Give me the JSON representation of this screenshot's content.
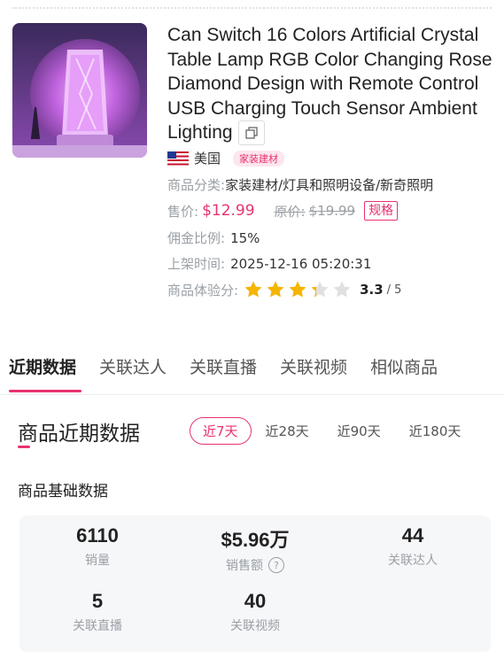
{
  "product": {
    "title": "Can Switch 16 Colors Artificial Crystal Table Lamp RGB Color Changing Rose Diamond Design with Remote Control USB Charging Touch Sensor Ambient Lighting",
    "country": "美国",
    "category_tag": "家装建材",
    "category_label": "商品分类:",
    "category_value": "家装建材/灯具和照明设备/新奇照明",
    "price_label": "售价:",
    "price": "$12.99",
    "original_price_label": "原价:",
    "original_price": "$19.99",
    "spec_button": "规格",
    "commission_label": "佣金比例:",
    "commission": "15%",
    "listed_label": "上架时间:",
    "listed_time": "2025-12-16 05:20:31",
    "rating_label": "商品体验分:",
    "rating": 3.3,
    "rating_text": "3.3",
    "rating_max": "/ 5"
  },
  "tabs": [
    "近期数据",
    "关联达人",
    "关联直播",
    "关联视频",
    "相似商品"
  ],
  "active_tab": 0,
  "section": {
    "title": "商品近期数据",
    "periods": [
      "近7天",
      "近28天",
      "近90天",
      "近180天"
    ],
    "active_period": 0,
    "sub_title": "商品基础数据"
  },
  "stats": [
    {
      "value": "6110",
      "label": "销量"
    },
    {
      "value": "$5.96万",
      "label": "销售额"
    },
    {
      "value": "44",
      "label": "关联达人"
    },
    {
      "value": "5",
      "label": "关联直播"
    },
    {
      "value": "40",
      "label": "关联视频"
    }
  ],
  "colors": {
    "accent": "#e8336d",
    "muted": "#9aa0a6",
    "star": "#f5b400"
  },
  "icons": {
    "copy": "copy-icon",
    "help": "help-icon",
    "flag": "us-flag-icon"
  }
}
